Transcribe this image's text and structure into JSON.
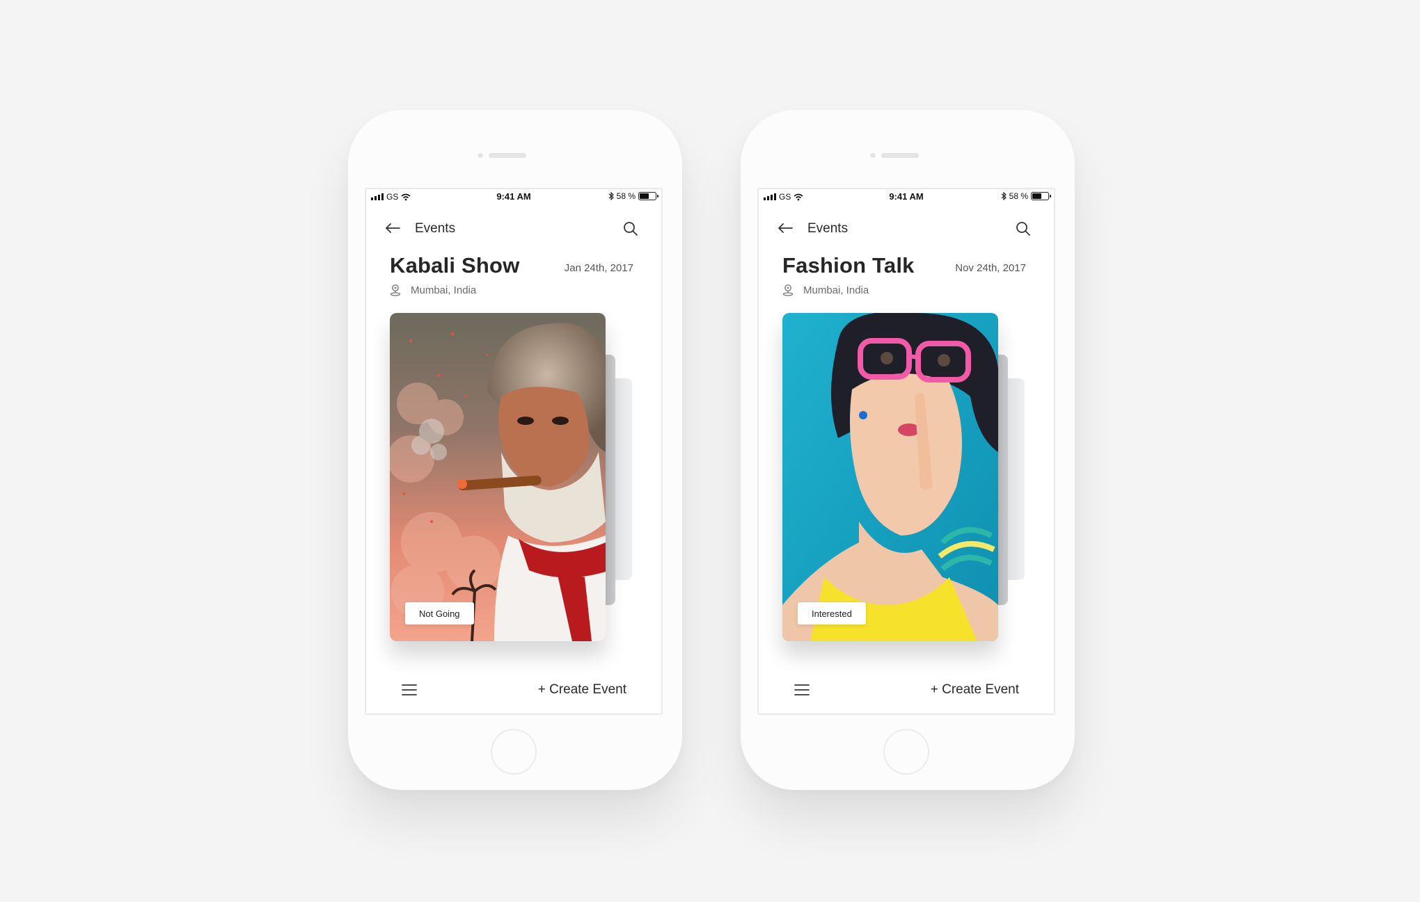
{
  "colors": {
    "background": "#f4f4f5",
    "phone": "#fcfcfd",
    "text": "#2a2a2a"
  },
  "phones": [
    {
      "status": {
        "carrier": "GS",
        "time": "9:41 AM",
        "battery": "58 %"
      },
      "nav": {
        "title": "Events",
        "back_icon": "arrow-left-icon",
        "search_icon": "search-icon"
      },
      "event": {
        "title": "Kabali Show",
        "date": "Jan 24th, 2017",
        "location": "Mumbai, India",
        "rsvp": "Not Going"
      },
      "bottom": {
        "menu_icon": "hamburger-menu-icon",
        "create": "+ Create Event"
      }
    },
    {
      "status": {
        "carrier": "GS",
        "time": "9:41 AM",
        "battery": "58 %"
      },
      "nav": {
        "title": "Events",
        "back_icon": "arrow-left-icon",
        "search_icon": "search-icon"
      },
      "event": {
        "title": "Fashion Talk",
        "date": "Nov 24th, 2017",
        "location": "Mumbai, India",
        "rsvp": "Interested"
      },
      "bottom": {
        "menu_icon": "hamburger-menu-icon",
        "create": "+ Create Event"
      }
    }
  ]
}
